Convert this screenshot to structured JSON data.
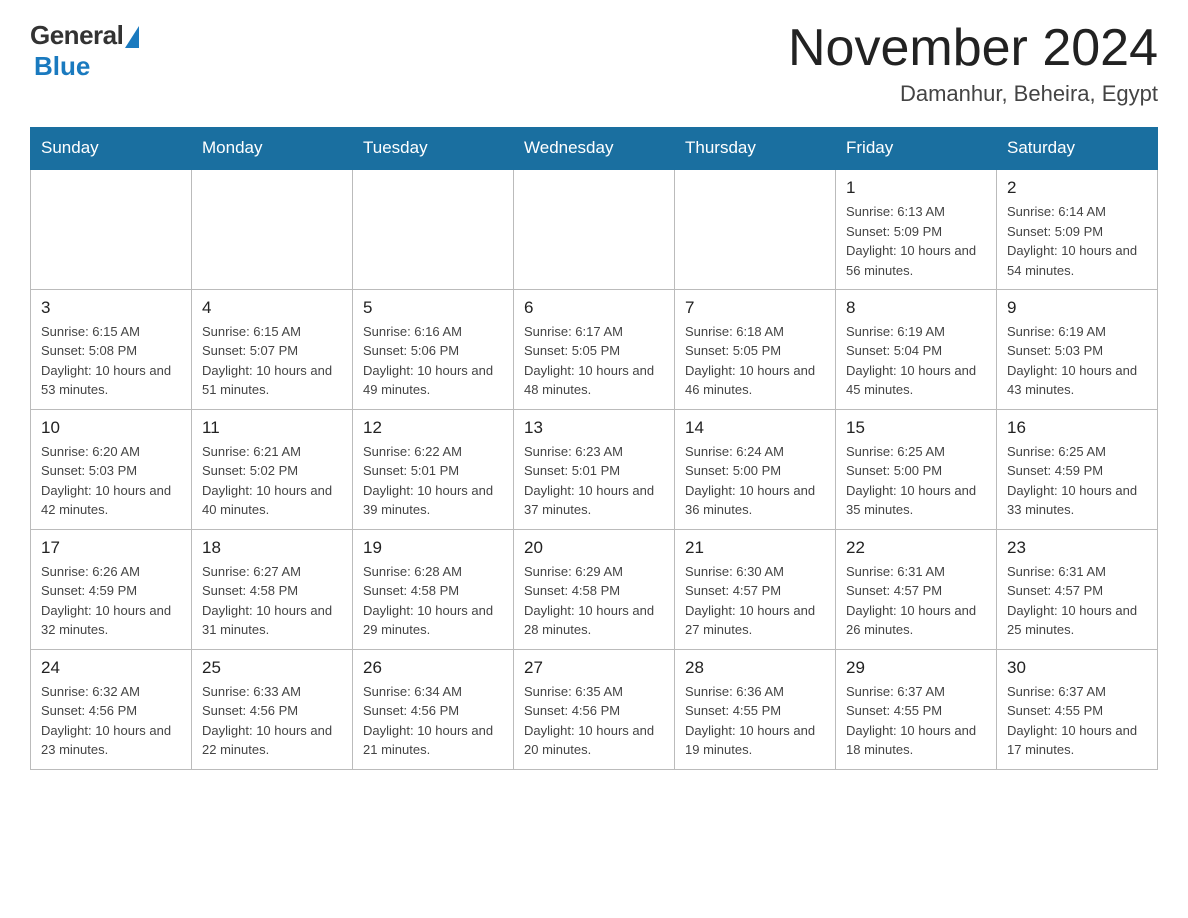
{
  "header": {
    "logo_general": "General",
    "logo_blue": "Blue",
    "month_title": "November 2024",
    "location": "Damanhur, Beheira, Egypt"
  },
  "days_of_week": [
    "Sunday",
    "Monday",
    "Tuesday",
    "Wednesday",
    "Thursday",
    "Friday",
    "Saturday"
  ],
  "weeks": [
    [
      {
        "day": "",
        "info": ""
      },
      {
        "day": "",
        "info": ""
      },
      {
        "day": "",
        "info": ""
      },
      {
        "day": "",
        "info": ""
      },
      {
        "day": "",
        "info": ""
      },
      {
        "day": "1",
        "info": "Sunrise: 6:13 AM\nSunset: 5:09 PM\nDaylight: 10 hours and 56 minutes."
      },
      {
        "day": "2",
        "info": "Sunrise: 6:14 AM\nSunset: 5:09 PM\nDaylight: 10 hours and 54 minutes."
      }
    ],
    [
      {
        "day": "3",
        "info": "Sunrise: 6:15 AM\nSunset: 5:08 PM\nDaylight: 10 hours and 53 minutes."
      },
      {
        "day": "4",
        "info": "Sunrise: 6:15 AM\nSunset: 5:07 PM\nDaylight: 10 hours and 51 minutes."
      },
      {
        "day": "5",
        "info": "Sunrise: 6:16 AM\nSunset: 5:06 PM\nDaylight: 10 hours and 49 minutes."
      },
      {
        "day": "6",
        "info": "Sunrise: 6:17 AM\nSunset: 5:05 PM\nDaylight: 10 hours and 48 minutes."
      },
      {
        "day": "7",
        "info": "Sunrise: 6:18 AM\nSunset: 5:05 PM\nDaylight: 10 hours and 46 minutes."
      },
      {
        "day": "8",
        "info": "Sunrise: 6:19 AM\nSunset: 5:04 PM\nDaylight: 10 hours and 45 minutes."
      },
      {
        "day": "9",
        "info": "Sunrise: 6:19 AM\nSunset: 5:03 PM\nDaylight: 10 hours and 43 minutes."
      }
    ],
    [
      {
        "day": "10",
        "info": "Sunrise: 6:20 AM\nSunset: 5:03 PM\nDaylight: 10 hours and 42 minutes."
      },
      {
        "day": "11",
        "info": "Sunrise: 6:21 AM\nSunset: 5:02 PM\nDaylight: 10 hours and 40 minutes."
      },
      {
        "day": "12",
        "info": "Sunrise: 6:22 AM\nSunset: 5:01 PM\nDaylight: 10 hours and 39 minutes."
      },
      {
        "day": "13",
        "info": "Sunrise: 6:23 AM\nSunset: 5:01 PM\nDaylight: 10 hours and 37 minutes."
      },
      {
        "day": "14",
        "info": "Sunrise: 6:24 AM\nSunset: 5:00 PM\nDaylight: 10 hours and 36 minutes."
      },
      {
        "day": "15",
        "info": "Sunrise: 6:25 AM\nSunset: 5:00 PM\nDaylight: 10 hours and 35 minutes."
      },
      {
        "day": "16",
        "info": "Sunrise: 6:25 AM\nSunset: 4:59 PM\nDaylight: 10 hours and 33 minutes."
      }
    ],
    [
      {
        "day": "17",
        "info": "Sunrise: 6:26 AM\nSunset: 4:59 PM\nDaylight: 10 hours and 32 minutes."
      },
      {
        "day": "18",
        "info": "Sunrise: 6:27 AM\nSunset: 4:58 PM\nDaylight: 10 hours and 31 minutes."
      },
      {
        "day": "19",
        "info": "Sunrise: 6:28 AM\nSunset: 4:58 PM\nDaylight: 10 hours and 29 minutes."
      },
      {
        "day": "20",
        "info": "Sunrise: 6:29 AM\nSunset: 4:58 PM\nDaylight: 10 hours and 28 minutes."
      },
      {
        "day": "21",
        "info": "Sunrise: 6:30 AM\nSunset: 4:57 PM\nDaylight: 10 hours and 27 minutes."
      },
      {
        "day": "22",
        "info": "Sunrise: 6:31 AM\nSunset: 4:57 PM\nDaylight: 10 hours and 26 minutes."
      },
      {
        "day": "23",
        "info": "Sunrise: 6:31 AM\nSunset: 4:57 PM\nDaylight: 10 hours and 25 minutes."
      }
    ],
    [
      {
        "day": "24",
        "info": "Sunrise: 6:32 AM\nSunset: 4:56 PM\nDaylight: 10 hours and 23 minutes."
      },
      {
        "day": "25",
        "info": "Sunrise: 6:33 AM\nSunset: 4:56 PM\nDaylight: 10 hours and 22 minutes."
      },
      {
        "day": "26",
        "info": "Sunrise: 6:34 AM\nSunset: 4:56 PM\nDaylight: 10 hours and 21 minutes."
      },
      {
        "day": "27",
        "info": "Sunrise: 6:35 AM\nSunset: 4:56 PM\nDaylight: 10 hours and 20 minutes."
      },
      {
        "day": "28",
        "info": "Sunrise: 6:36 AM\nSunset: 4:55 PM\nDaylight: 10 hours and 19 minutes."
      },
      {
        "day": "29",
        "info": "Sunrise: 6:37 AM\nSunset: 4:55 PM\nDaylight: 10 hours and 18 minutes."
      },
      {
        "day": "30",
        "info": "Sunrise: 6:37 AM\nSunset: 4:55 PM\nDaylight: 10 hours and 17 minutes."
      }
    ]
  ]
}
